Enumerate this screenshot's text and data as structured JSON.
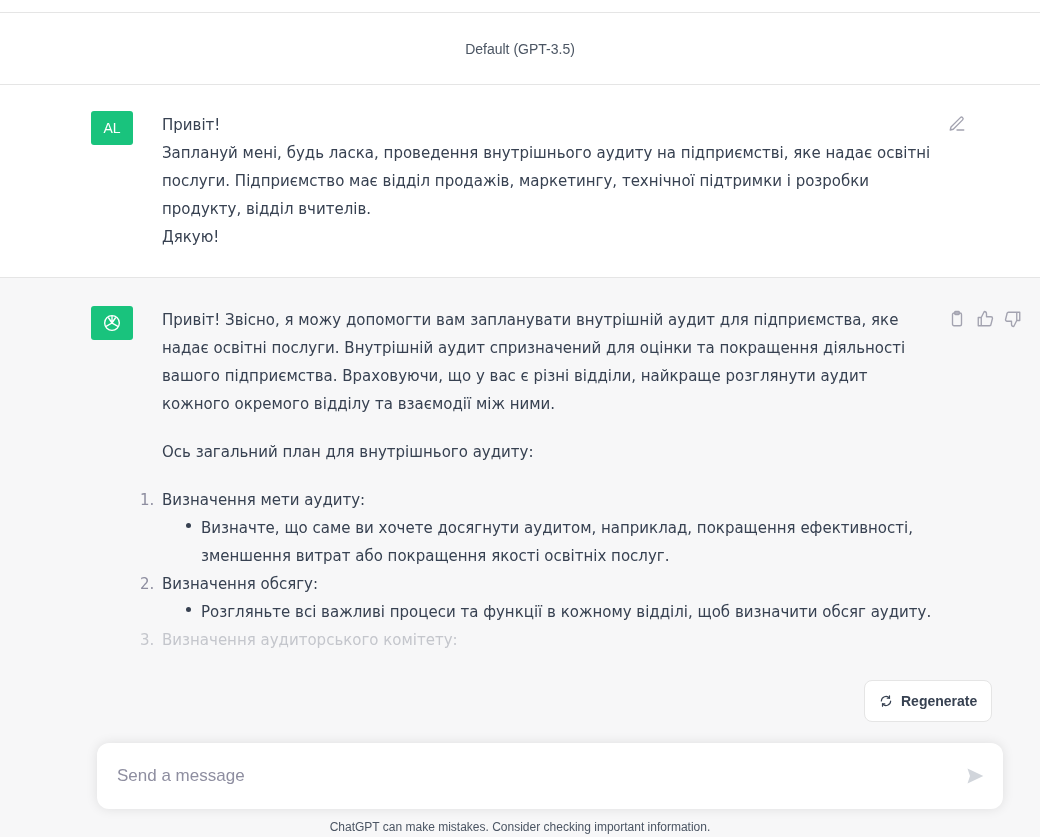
{
  "header": {
    "title": "Default (GPT-3.5)"
  },
  "messages": [
    {
      "kind": "user",
      "avatar": "AL",
      "lines": [
        "Привіт!",
        "Заплануй мені, будь ласка, проведення внутрішнього аудиту на підприємстві, яке надає освітні послуги. Підприємство має відділ продажів, маркетингу, технічної підтримки і розробки продукту, відділ вчителів.",
        "Дякую!"
      ]
    },
    {
      "kind": "assistant",
      "paragraphs": [
        "Привіт! Звісно, я можу допомогти вам запланувати внутрішній аудит для підприємства, яке надає освітні послуги. Внутрішній аудит спризначений для оцінки та покращення діяльності вашого підприємства. Враховуючи, що у вас є різні відділи, найкраще розглянути аудит кожного окремого відділу та взаємодії між ними.",
        "Ось загальний план для внутрішнього аудиту:"
      ],
      "list": [
        {
          "number": "1.",
          "title": "Визначення мети аудиту:",
          "faded": false,
          "bullets": [
            "Визначте, що саме ви хочете досягнути аудитом, наприклад, покращення ефективності, зменшення витрат або покращення якості освітніх послуг."
          ]
        },
        {
          "number": "2.",
          "title": "Визначення обсягу:",
          "faded": false,
          "bullets": [
            "Розгляньте всі важливі процеси та функції в кожному відділі, щоб визначити обсяг аудиту."
          ]
        },
        {
          "number": "3.",
          "title": "Визначення аудиторського комітету:",
          "faded": true
        }
      ]
    }
  ],
  "regenerate": {
    "label": "Regenerate"
  },
  "composer": {
    "placeholder": "Send a message"
  },
  "footer": "ChatGPT can make mistakes. Consider checking important information."
}
